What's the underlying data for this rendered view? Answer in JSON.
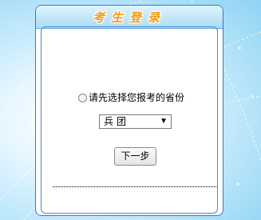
{
  "login_panel": {
    "title": "考生登录",
    "radio_label": "请先选择您报考的省份",
    "province_select": {
      "selected_value": "兵团"
    },
    "next_button_label": "下一步"
  },
  "colors": {
    "title_text": "#f39a16",
    "panel_border": "#3a76c6",
    "background_light": "#e6f6ff",
    "background_accent": "#8fd3f4"
  }
}
